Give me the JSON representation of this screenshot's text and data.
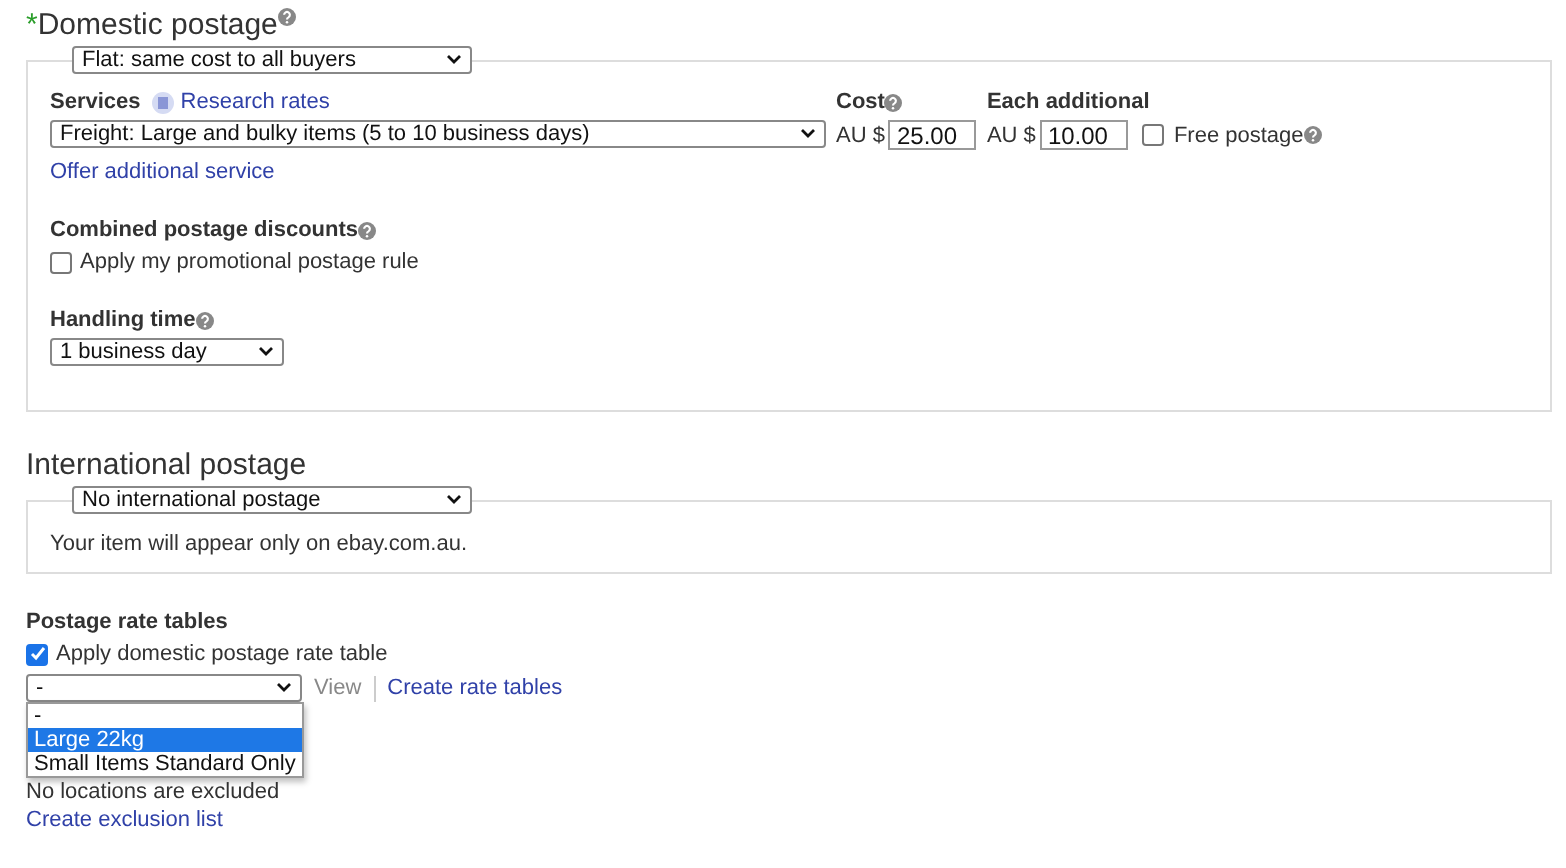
{
  "domestic": {
    "required_mark": "*",
    "title": "Domestic postage",
    "type_select": "Flat: same cost to all buyers",
    "services_label": "Services",
    "research_link": "Research rates",
    "service_select": "Freight: Large and bulky items (5 to 10 business days)",
    "cost_label": "Cost",
    "cost_currency": "AU $",
    "cost_value": "25.00",
    "additional_label": "Each additional",
    "additional_currency": "AU $",
    "additional_value": "10.00",
    "free_postage": {
      "label": "Free postage",
      "checked": false
    },
    "offer_link": "Offer additional service",
    "combined_label": "Combined postage discounts",
    "promo_rule": {
      "label": "Apply my promotional postage rule",
      "checked": false
    },
    "handling_label": "Handling time",
    "handling_select": "1 business day"
  },
  "international": {
    "title": "International postage",
    "type_select": "No international postage",
    "note": "Your item will appear only on ebay.com.au."
  },
  "rate_tables": {
    "title": "Postage rate tables",
    "apply": {
      "label": "Apply domestic postage rate table",
      "checked": true
    },
    "select": "-",
    "options": [
      {
        "label": "-",
        "selected": false
      },
      {
        "label": "Large 22kg",
        "selected": true
      },
      {
        "label": "Small Items Standard Only",
        "selected": false
      }
    ],
    "view_link": "View",
    "create_link": "Create rate tables"
  },
  "exclusions": {
    "note": "No locations are excluded",
    "create_link": "Create exclusion list"
  }
}
